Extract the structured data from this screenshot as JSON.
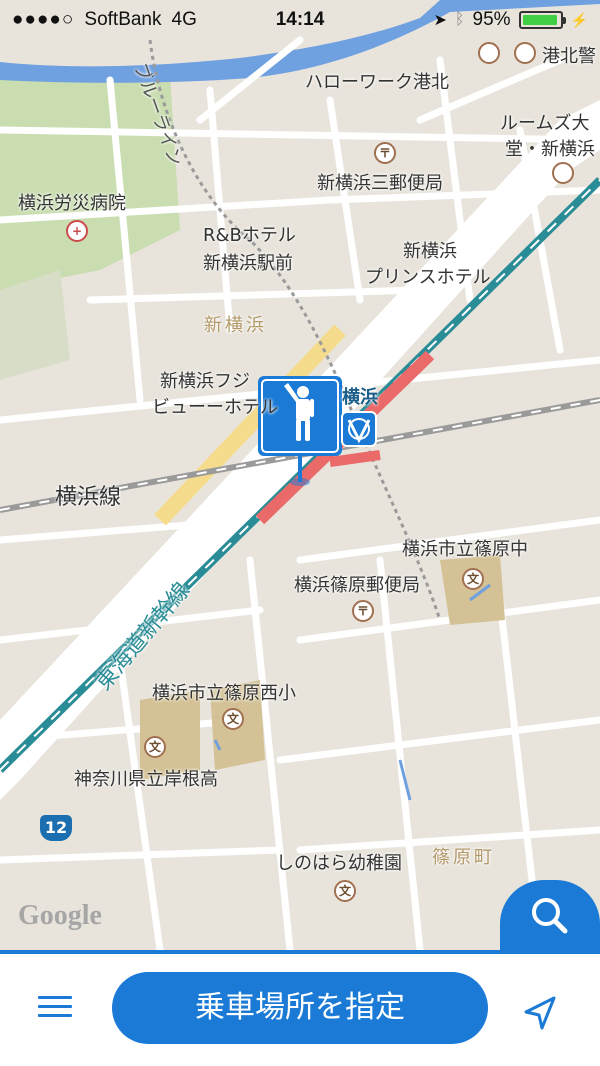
{
  "status": {
    "signal_dots": "●●●●○",
    "carrier": "SoftBank",
    "network": "4G",
    "time": "14:14",
    "battery_percent": "95%",
    "battery_level": 0.95
  },
  "map": {
    "labels": {
      "bluline": "ブルーライン",
      "hello_work": "ハローワーク港北",
      "kohoku": "港北警",
      "roomz": "ルームズ大",
      "roomz2": "堂・新横浜",
      "post_office": "新横浜三郵便局",
      "rosai": "横浜労災病院",
      "rb_hotel1": "R&Bホテル",
      "rb_hotel2": "新横浜駅前",
      "prince1": "新横浜",
      "prince2": "プリンスホテル",
      "shinyokohama_area": "新横浜",
      "fuji1": "新横浜フジ",
      "fuji2": "ビューーホテル",
      "yokohama_station": "横浜",
      "yokohama_line": "横浜線",
      "shinohara_jhs": "横浜市立篠原中",
      "shinohara_post": "横浜篠原郵便局",
      "tokaido": "東海道新幹線",
      "shinohara_west": "横浜市立篠原西小",
      "kishine_hs": "神奈川県立岸根高",
      "kindergarten": "しのはら幼稚園",
      "shinohara_town": "篠原町",
      "route": "12",
      "google": "Google",
      "school_mark": "文",
      "post_mark": "〒",
      "hospital_mark": "+"
    },
    "pin_icon": "walking-person-icon"
  },
  "bottom": {
    "menu_icon": "hamburger-menu-icon",
    "main_button": "乗車場所を指定",
    "location_icon": "navigation-arrow-icon",
    "search_icon": "magnifier-icon"
  },
  "colors": {
    "accent": "#1a7ad6",
    "rail_teal": "#2a8c96",
    "station_red": "#ea6a6a",
    "road_yellow": "#f5dc8c",
    "water": "#6fa0e0",
    "park": "#c9ddb0"
  }
}
